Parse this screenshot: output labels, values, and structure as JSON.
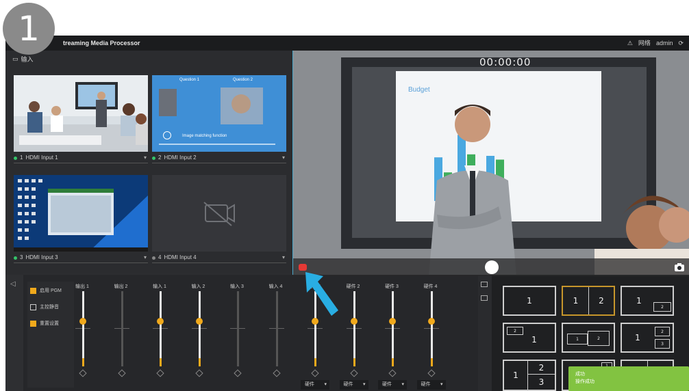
{
  "step_badge": "1",
  "titlebar": {
    "title": "treaming Media Processor",
    "right_items": [
      "⚠",
      "网络",
      "admin",
      "⟳"
    ]
  },
  "inputs": {
    "header": "输入",
    "tiles": [
      {
        "num": "1",
        "label": "HDMI Input 1"
      },
      {
        "num": "2",
        "label": "HDMI Input 2"
      },
      {
        "num": "3",
        "label": "HDMI Input 3"
      },
      {
        "num": "4",
        "label": "HDMI Input 4"
      }
    ],
    "slide_text": {
      "q1": "Question 1",
      "q2": "Question 2",
      "caption": "Image matching function"
    }
  },
  "preview": {
    "timecode": "00:00:00",
    "board_title": "Budget",
    "bars": [
      0.58,
      0.38,
      0.88,
      0.62,
      0.6,
      0.55
    ]
  },
  "mixer": {
    "options": [
      {
        "label": "启用 PGM",
        "checked": true
      },
      {
        "label": "主控静音",
        "checked": false
      },
      {
        "label": "重置设置",
        "checked": true
      }
    ],
    "channels": [
      {
        "label": "输出 1",
        "level": 0.6,
        "active": true
      },
      {
        "label": "输出 2",
        "level": 0.0,
        "active": false
      },
      {
        "label": "输入 1",
        "level": 0.6,
        "active": true
      },
      {
        "label": "输入 2",
        "level": 0.6,
        "active": true
      },
      {
        "label": "输入 3",
        "level": 0.0,
        "active": false
      },
      {
        "label": "输入 4",
        "level": 0.0,
        "active": false
      },
      {
        "label": "硬件 1",
        "level": 0.6,
        "active": true
      },
      {
        "label": "硬件 2",
        "level": 0.6,
        "active": true
      },
      {
        "label": "硬件 3",
        "level": 0.6,
        "active": true
      },
      {
        "label": "硬件 4",
        "level": 0.6,
        "active": true
      }
    ],
    "select_label": "硬件"
  },
  "layouts": {
    "buttons": [
      "1",
      "1 2",
      "1 2 pip",
      "1 pip",
      "2 pip",
      "1 2 3",
      "1 2 3 left",
      "pip",
      "1 2"
    ]
  },
  "toast": {
    "line1": "成功",
    "line2": "操作成功"
  },
  "colors": {
    "accent": "#f0a91c",
    "selected_layout": "#c7962b",
    "rec": "#e53935",
    "toast": "#82c341",
    "arrow": "#29aee3"
  }
}
